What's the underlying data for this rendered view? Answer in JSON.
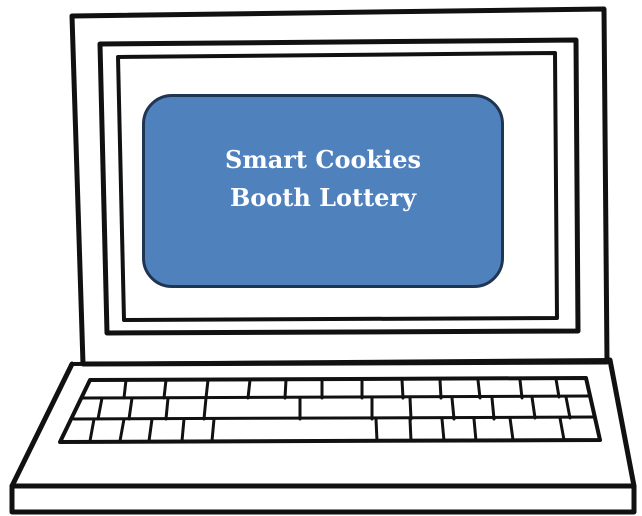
{
  "screen_panel": {
    "line1": "Smart Cookies",
    "line2": "Booth Lottery",
    "fill_color": "#4f81bd",
    "border_color": "#1f3552"
  },
  "illustration": {
    "subject": "laptop-outline",
    "stroke_color": "#111111"
  }
}
